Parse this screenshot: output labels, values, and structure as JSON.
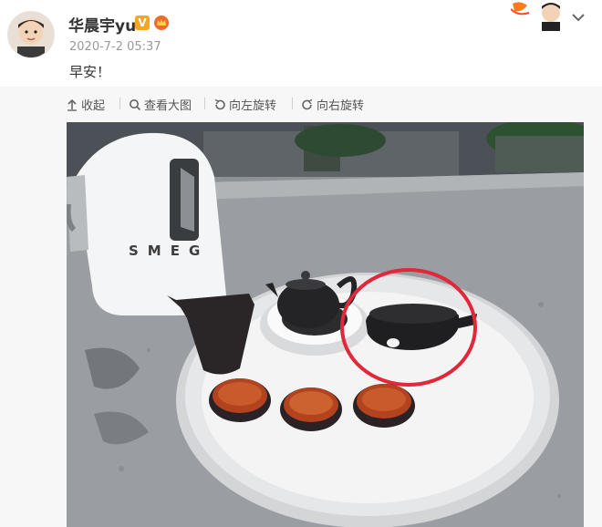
{
  "post": {
    "author_name": "华晨宇yu",
    "verified_badge": "V",
    "timestamp": "2020-7-2 05:37",
    "text": "早安！"
  },
  "toolbar": {
    "collapse_label": "收起",
    "view_large_label": "查看大图",
    "rotate_left_label": "向左旋转",
    "rotate_right_label": "向右旋转"
  },
  "photo": {
    "kettle_brand": "SMEG"
  },
  "icons": [
    "avatar",
    "verified-v-icon",
    "crown-badge-icon",
    "corner-avatar-badge",
    "chevron-down-icon",
    "collapse-arrow-icon",
    "magnifier-icon",
    "rotate-left-icon",
    "rotate-right-icon"
  ],
  "colors": {
    "accent_orange": "#f5a623",
    "highlight_circle": "#e0283a",
    "text_main": "#333333",
    "text_muted": "#9a9a9a"
  }
}
